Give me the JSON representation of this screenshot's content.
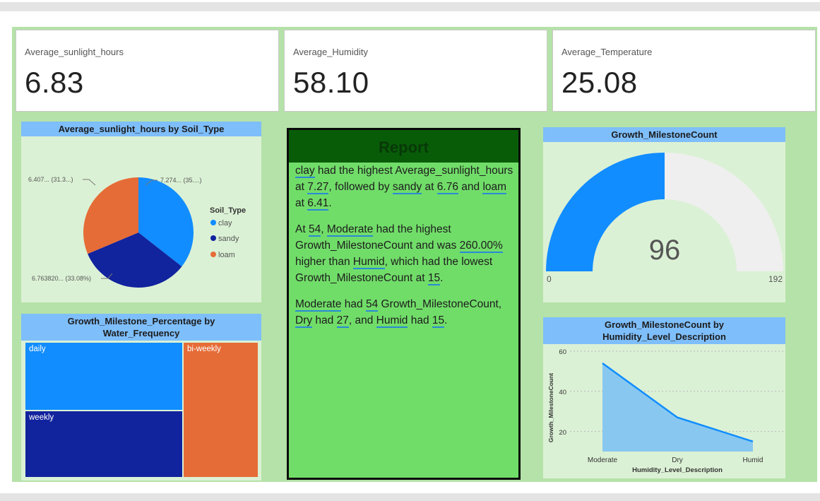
{
  "cards": [
    {
      "label": "Average_sunlight_hours",
      "value": "6.83"
    },
    {
      "label": "Average_Humidity",
      "value": "58.10"
    },
    {
      "label": "Average_Temperature",
      "value": "25.08"
    }
  ],
  "colors": {
    "clay": "#118dff",
    "sandy": "#12239e",
    "loam": "#e66c37",
    "header_blue": "#7ebefa",
    "report_bg": "#71dd69"
  },
  "report": {
    "title": "Report",
    "p1": {
      "a": "clay",
      "b": " had the highest Average_sunlight_hours at ",
      "c": "7.27",
      "d": ", followed by ",
      "e": "sandy",
      "f": " at ",
      "g": "6.76",
      "h": " and ",
      "i": "loam",
      "j": " at ",
      "k": "6.41",
      "l": "."
    },
    "p2": {
      "a": "At ",
      "b": "54",
      "c": ", ",
      "d": "Moderate",
      "e": " had the highest Growth_MilestoneCount and was ",
      "f": "260.00%",
      "g": " higher than ",
      "h": "Humid",
      "i": ", which had the lowest Growth_MilestoneCount at ",
      "j": "15",
      "k": "."
    },
    "p3": {
      "a": "Moderate",
      "b": " had ",
      "c": "54",
      "d": " Growth_MilestoneCount, ",
      "e": "Dry",
      "f": " had ",
      "g": "27",
      "h": ", and ",
      "i": "Humid",
      "j": " had ",
      "k": "15",
      "l": "."
    }
  },
  "chart_data": [
    {
      "type": "pie",
      "title": "Average_sunlight_hours by Soil_Type",
      "legend_title": "Soil_Type",
      "legend_position": "right",
      "categories": [
        "clay",
        "sandy",
        "loam"
      ],
      "values": [
        7.274,
        6.76382,
        6.407
      ],
      "data_labels": [
        "7.274... (35....)",
        "6.763820... (33.08%)",
        "6.407... (31.3...)"
      ]
    },
    {
      "type": "treemap",
      "title": "Growth_Milestone_Percentage by Water_Frequency",
      "categories": [
        "daily",
        "weekly",
        "bi-weekly"
      ],
      "values": [
        0.35,
        0.34,
        0.31
      ]
    },
    {
      "type": "gauge",
      "title": "Growth_MilestoneCount",
      "value": 96,
      "min": 0,
      "max": 192,
      "value_label": "96",
      "min_label": "0",
      "max_label": "192"
    },
    {
      "type": "area",
      "title": "Growth_MilestoneCount by Humidity_Level_Description",
      "xlabel": "Humidity_Level_Description",
      "ylabel": "Growth_MilestoneCount",
      "categories": [
        "Moderate",
        "Dry",
        "Humid"
      ],
      "values": [
        54,
        27,
        15
      ],
      "ylim": [
        10,
        60
      ],
      "yticks": [
        "20",
        "40",
        "60"
      ],
      "grid": true
    }
  ]
}
